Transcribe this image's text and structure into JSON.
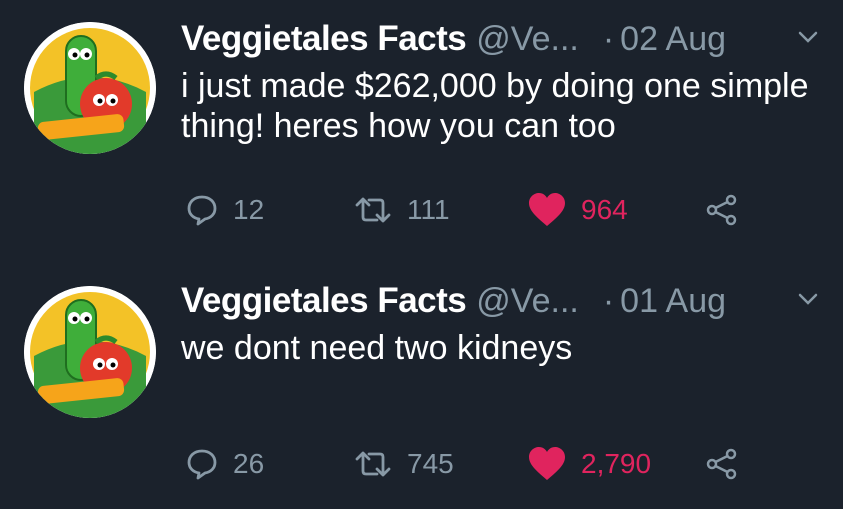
{
  "tweets": [
    {
      "author_name": "Veggietales Facts",
      "handle": "@Ve...",
      "separator": "·",
      "date": "02 Aug",
      "text": "i just made $262,000 by doing one simple thing! heres how you can too",
      "replies": "12",
      "retweets": "111",
      "likes": "964",
      "avatar_label": "VeggieTales"
    },
    {
      "author_name": "Veggietales Facts",
      "handle": "@Ve...",
      "separator": "·",
      "date": "01 Aug",
      "text": "we dont need two kidneys",
      "replies": "26",
      "retweets": "745",
      "likes": "2,790",
      "avatar_label": "VeggieTales"
    }
  ],
  "icons": {
    "reply": "speech-bubble-icon",
    "retweet": "retweet-arrows-icon",
    "like": "heart-icon",
    "share": "share-nodes-icon",
    "more": "chevron-down-icon"
  },
  "colors": {
    "background": "#1b222c",
    "muted": "#8899a6",
    "like": "#e0245e",
    "text": "#ffffff"
  }
}
